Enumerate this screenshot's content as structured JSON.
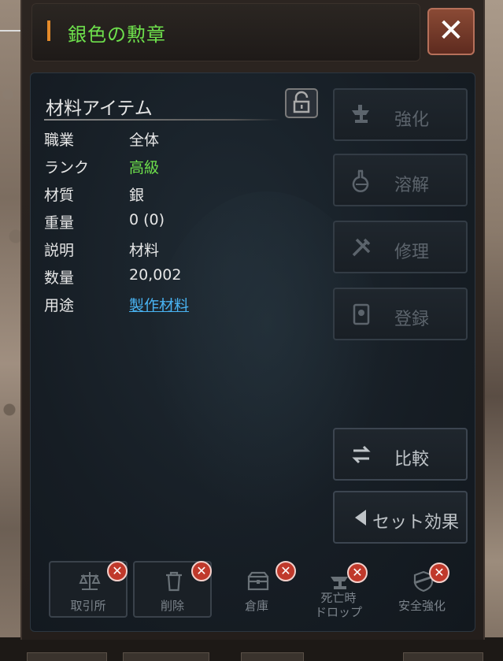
{
  "window": {
    "title": "銀色の勲章",
    "close_label": "✕"
  },
  "item": {
    "type": "材料アイテム",
    "rows": [
      {
        "label": "職業",
        "value": "全体",
        "style": "normal"
      },
      {
        "label": "ランク",
        "value": "高級",
        "style": "green"
      },
      {
        "label": "材質",
        "value": "銀",
        "style": "normal"
      },
      {
        "label": "重量",
        "value": "0 (0)",
        "style": "normal"
      },
      {
        "label": "説明",
        "value": "材料",
        "style": "normal"
      },
      {
        "label": "数量",
        "value": "20,002",
        "style": "normal"
      },
      {
        "label": "用途",
        "value": "製作材料",
        "style": "link"
      }
    ]
  },
  "side_buttons": [
    {
      "label": "強化",
      "icon": "anvil-icon",
      "enabled": false
    },
    {
      "label": "溶解",
      "icon": "flask-icon",
      "enabled": false
    },
    {
      "label": "修理",
      "icon": "tools-icon",
      "enabled": false
    },
    {
      "label": "登録",
      "icon": "book-icon",
      "enabled": false
    },
    {
      "label": "比較",
      "icon": "swap-arrows-icon",
      "enabled": true
    },
    {
      "label": "セット効果",
      "icon": "triangle-left-icon",
      "enabled": true
    }
  ],
  "bottom_buttons": [
    {
      "label": "取引所",
      "icon": "scales-icon",
      "framed": true
    },
    {
      "label": "削除",
      "icon": "trash-icon",
      "framed": true
    },
    {
      "label": "倉庫",
      "icon": "chest-icon",
      "framed": false
    },
    {
      "label": "死亡時\nドロップ",
      "icon": "anvil-drop-icon",
      "framed": false
    },
    {
      "label": "安全強化",
      "icon": "shield-icon",
      "framed": false
    }
  ],
  "colors": {
    "accent_green": "#6ee04c",
    "link_blue": "#49b3f2",
    "close_red": "#8a4a35",
    "badge_red": "#c0392b",
    "title_mark_orange": "#e48a2a"
  }
}
